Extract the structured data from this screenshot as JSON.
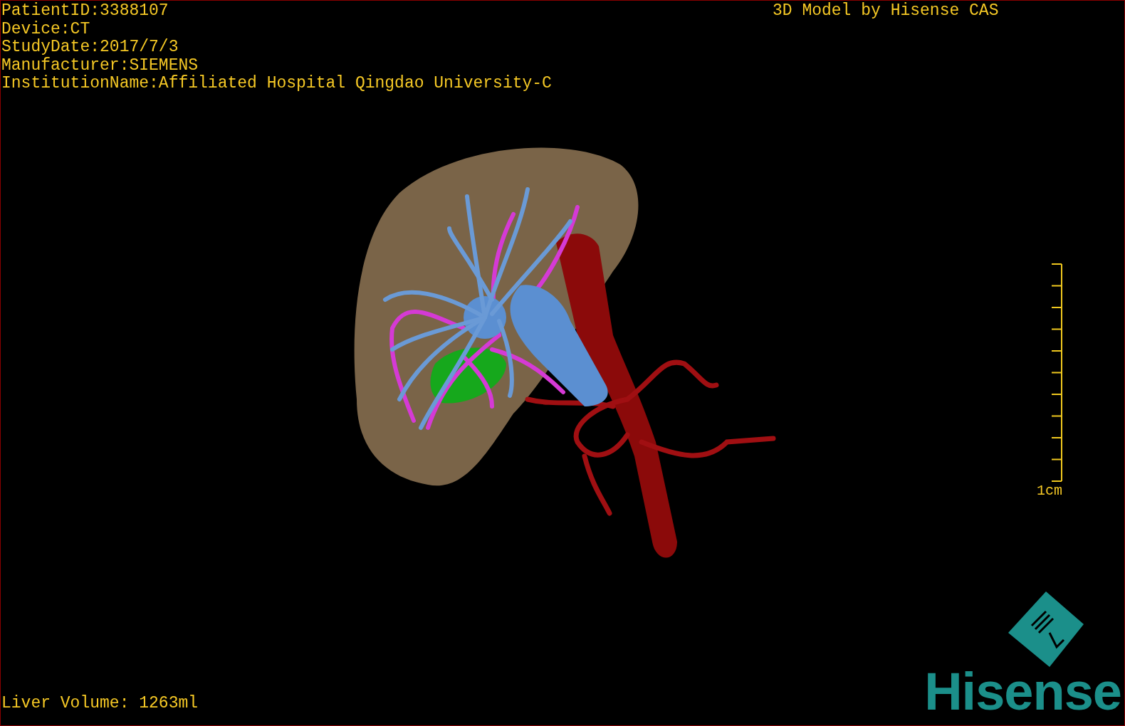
{
  "info_lines": [
    "PatientID:3388107",
    "Device:CT",
    "StudyDate:2017/7/3",
    "Manufacturer:SIEMENS",
    "InstitutionName:Affiliated Hospital Qingdao University-C"
  ],
  "credit": "3D Model by Hisense CAS",
  "scale_label": "1cm",
  "volume": "Liver Volume: 1263ml",
  "logo_text": "Hisense"
}
